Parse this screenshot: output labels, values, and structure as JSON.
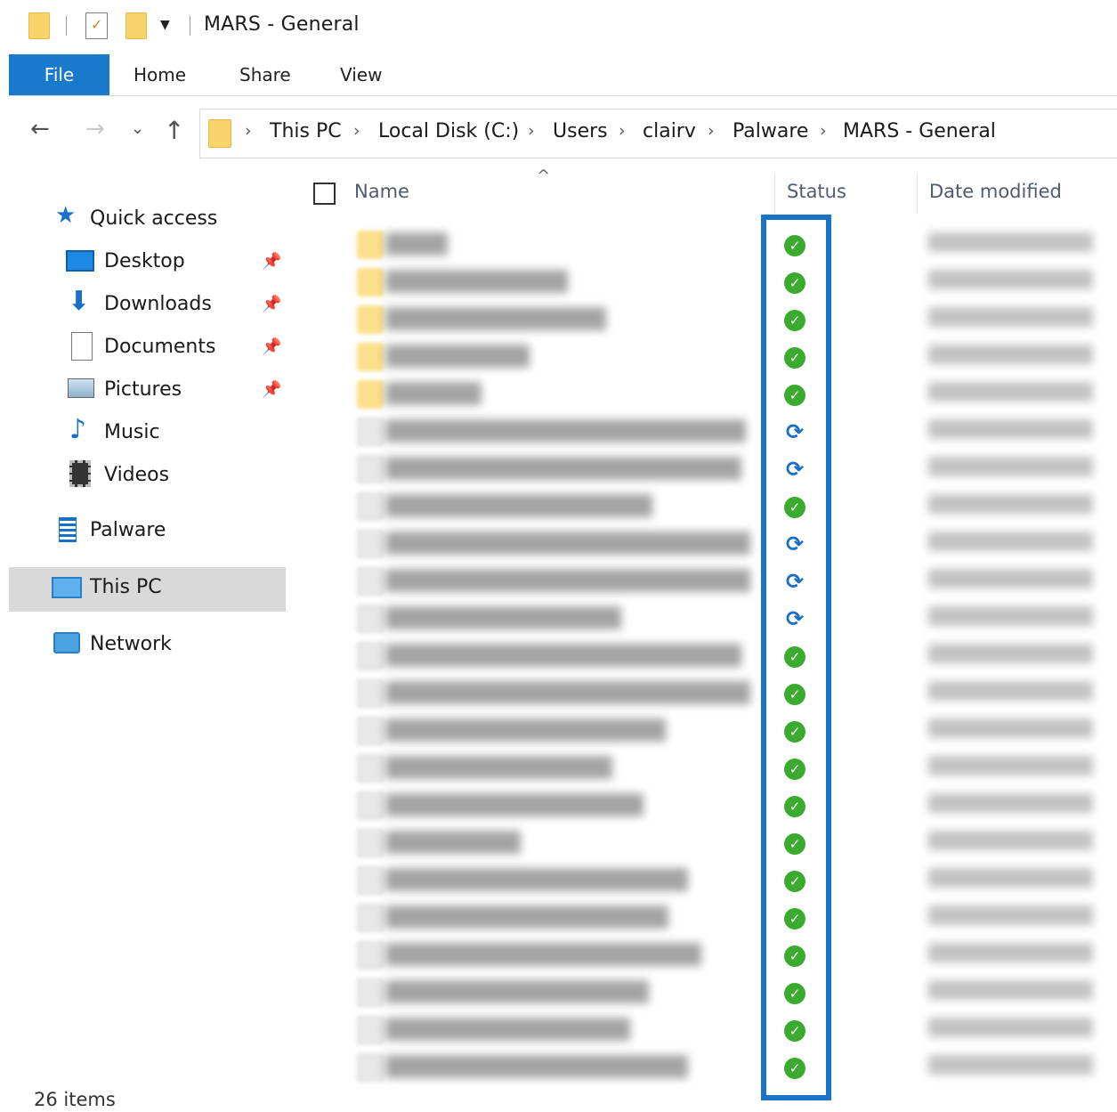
{
  "window": {
    "title": "MARS - General"
  },
  "quick_toolbar": {
    "dropdown_icon": "customize-toolbar-icon"
  },
  "ribbon": {
    "tabs": [
      {
        "label": "File",
        "active": true
      },
      {
        "label": "Home"
      },
      {
        "label": "Share"
      },
      {
        "label": "View"
      }
    ],
    "accent_color": "#1979ca"
  },
  "navigation": {
    "back_icon": "←",
    "forward_icon": "→",
    "recent_icon": "⌄",
    "up_icon": "↑"
  },
  "breadcrumb": [
    "This PC",
    "Local Disk (C:)",
    "Users",
    "clairv",
    "Palware",
    "MARS - General"
  ],
  "nav_pane": {
    "quick_access": "Quick access",
    "pinned": [
      {
        "label": "Desktop",
        "icon": "desktop-icon",
        "pinned": true
      },
      {
        "label": "Downloads",
        "icon": "downloads-icon",
        "pinned": true
      },
      {
        "label": "Documents",
        "icon": "documents-icon",
        "pinned": true
      },
      {
        "label": "Pictures",
        "icon": "pictures-icon",
        "pinned": true
      },
      {
        "label": "Music",
        "icon": "music-icon",
        "pinned": false
      },
      {
        "label": "Videos",
        "icon": "videos-icon",
        "pinned": false
      }
    ],
    "palware": "Palware",
    "this_pc": "This PC",
    "network": "Network",
    "pin_glyph": "📌"
  },
  "columns": {
    "name": "Name",
    "status": "Status",
    "date_modified": "Date modified",
    "sort_glyph": "^"
  },
  "status_colors": {
    "synced": "#3bab2f",
    "syncing": "#1a70c8",
    "highlight": "#1a72c9"
  },
  "status_glyphs": {
    "synced": "✓",
    "syncing": "⟳"
  },
  "files": [
    {
      "type": "folder",
      "status": "synced"
    },
    {
      "type": "folder",
      "status": "synced"
    },
    {
      "type": "folder",
      "status": "synced"
    },
    {
      "type": "folder",
      "status": "synced"
    },
    {
      "type": "folder",
      "status": "synced"
    },
    {
      "type": "file",
      "status": "syncing"
    },
    {
      "type": "file",
      "status": "syncing"
    },
    {
      "type": "file",
      "status": "synced"
    },
    {
      "type": "file",
      "status": "syncing"
    },
    {
      "type": "file",
      "status": "syncing"
    },
    {
      "type": "file",
      "status": "syncing"
    },
    {
      "type": "file",
      "status": "synced"
    },
    {
      "type": "file",
      "status": "synced"
    },
    {
      "type": "file",
      "status": "synced"
    },
    {
      "type": "file",
      "status": "synced"
    },
    {
      "type": "file",
      "status": "synced"
    },
    {
      "type": "file",
      "status": "synced"
    },
    {
      "type": "file",
      "status": "synced"
    },
    {
      "type": "file",
      "status": "synced"
    },
    {
      "type": "file",
      "status": "synced"
    },
    {
      "type": "file",
      "status": "synced"
    },
    {
      "type": "file",
      "status": "synced"
    },
    {
      "type": "file",
      "status": "synced"
    }
  ],
  "status_bar": {
    "item_count": "26 items"
  }
}
